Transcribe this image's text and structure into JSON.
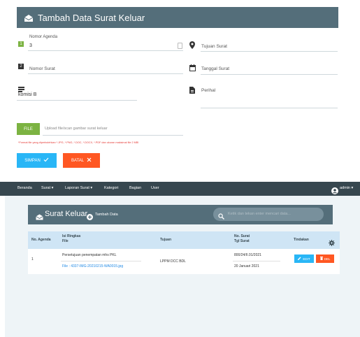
{
  "form": {
    "title": "Tambah Data Surat Keluar",
    "nomor_agenda_label": "Nomor Agenda",
    "nomor_agenda_value": "3",
    "tujuan_surat_placeholder": "Tujuan Surat",
    "nomor_surat_placeholder": "Nomor Surat",
    "tanggal_surat_placeholder": "Tanggal Surat",
    "isi_value": "komisi B",
    "perihal_placeholder": "Perihal",
    "file_button": "FILE",
    "file_placeholder": "Upload file/scan gambar surat keluar",
    "file_note": "*Format file yang diperbolehkan *.JPG, *.PNG, *.DOC, *.DOCX, *.PDF dan ukuran maksimal file 2 MB!",
    "simpan_label": "SIMPAN",
    "batal_label": "BATAL"
  },
  "navbar": {
    "items": [
      "Beranda",
      "Surat",
      "Laporan Surat",
      "Kategori",
      "Bagian",
      "User"
    ],
    "user": "admin"
  },
  "list": {
    "title": "Surat Keluar",
    "add_label": "Tambah Data",
    "search_placeholder": "Ketik dan tekan enter mencari data...",
    "columns": {
      "no_agenda": "No. Agenda",
      "isi_ringkas": "Isi Ringkas",
      "file": "File",
      "tujuan": "Tujuan",
      "no_surat": "No. Surat",
      "tgl_surat": "Tgl Surat",
      "tindakan": "Tindakan"
    },
    "rows": [
      {
        "no_agenda": "1",
        "isi_ringkas": "Persetujuan penempatan mhs PKL",
        "file_label": "File :",
        "file_name": "4337-IMG-20210215-WA0015.jpg",
        "tujuan": "LPPM DCC BDL",
        "no_surat": "800/24/II.01/2021",
        "tgl_surat": "20 Januari 2021",
        "edit_label": "EDIT",
        "del_label": "DEL"
      }
    ]
  },
  "colors": {
    "header": "#546e7a",
    "navbar": "#37474f",
    "file_button": "#7cb342",
    "simpan": "#29b6f6",
    "batal": "#ff5722",
    "table_head": "#cfe5f5"
  }
}
